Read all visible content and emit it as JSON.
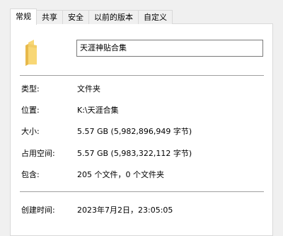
{
  "tabs": [
    "常规",
    "共享",
    "安全",
    "以前的版本",
    "自定义"
  ],
  "active_tab": "常规",
  "folder_name": "天涯神贴合集",
  "properties": {
    "type": {
      "label": "类型:",
      "value": "文件夹"
    },
    "location": {
      "label": "位置:",
      "value": "K:\\天涯合集"
    },
    "size": {
      "label": "大小:",
      "value": "5.57 GB (5,982,896,949 字节)"
    },
    "size_on_disk": {
      "label": "占用空间:",
      "value": "5.57 GB (5,983,322,112 字节)"
    },
    "contains": {
      "label": "包含:",
      "value": "205 个文件，0 个文件夹"
    },
    "created": {
      "label": "创建时间:",
      "value": "2023年7月2日，23:05:05"
    }
  },
  "colors": {
    "folder_light": "#f8d775",
    "folder_dark": "#e7b94b"
  },
  "icons": {
    "folder": "folder-icon"
  }
}
